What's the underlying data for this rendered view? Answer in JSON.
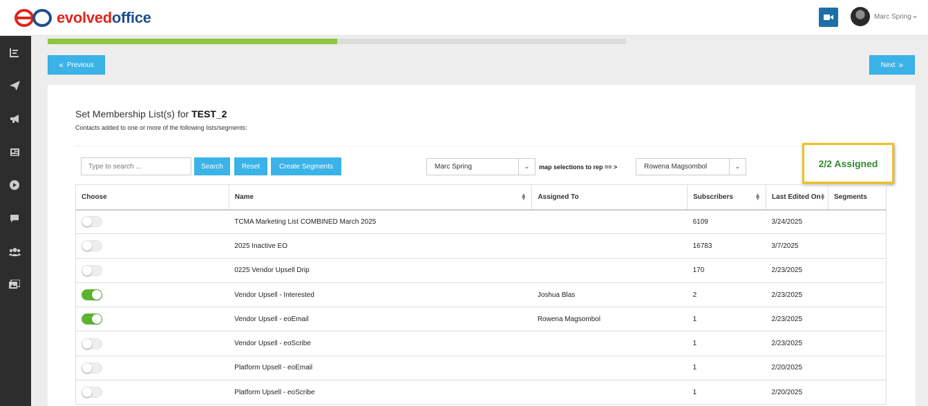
{
  "header": {
    "logo_part1": "evolved",
    "logo_part2": "office",
    "user_name": "Marc Spring"
  },
  "sidebar": {
    "items": [
      "chart-icon",
      "send-icon",
      "megaphone-icon",
      "newspaper-icon",
      "play-icon",
      "chat-icon",
      "users-icon",
      "gallery-icon"
    ]
  },
  "progress": {
    "fraction": 0.5
  },
  "nav": {
    "previous_label": "Previous",
    "next_label": "Next"
  },
  "main": {
    "title_prefix": "Set Membership List(s) for",
    "title_name": "TEST_2",
    "subtitle": "Contacts added to one or more of the following lists/segments:",
    "search_placeholder": "Type to search ...",
    "search_label": "Search",
    "reset_label": "Reset",
    "create_segments_label": "Create Segments",
    "rep_select_value": "Marc Spring",
    "map_label": "map selections to rep == >",
    "target_select_value": "Rowena Magsombol",
    "assigned_text": "2/2 Assigned"
  },
  "table": {
    "columns": [
      "Choose",
      "Name",
      "Assigned To",
      "Subscribers",
      "Last Edited On",
      "Segments"
    ],
    "rows": [
      {
        "on": false,
        "name": "TCMA Marketing List COMBINED March 2025",
        "assigned": "",
        "subscribers": "6109",
        "edited": "3/24/2025",
        "segments": ""
      },
      {
        "on": false,
        "name": "2025 Inactive EO",
        "assigned": "",
        "subscribers": "16783",
        "edited": "3/7/2025",
        "segments": ""
      },
      {
        "on": false,
        "name": "0225 Vendor Upsell Drip",
        "assigned": "",
        "subscribers": "170",
        "edited": "2/23/2025",
        "segments": ""
      },
      {
        "on": true,
        "name": "Vendor Upsell - Interested",
        "assigned": "Joshua Blas",
        "subscribers": "2",
        "edited": "2/23/2025",
        "segments": ""
      },
      {
        "on": true,
        "name": "Vendor Upsell - eoEmail",
        "assigned": "Rowena Magsombol",
        "subscribers": "1",
        "edited": "2/23/2025",
        "segments": ""
      },
      {
        "on": false,
        "name": "Vendor Upsell - eoScribe",
        "assigned": "",
        "subscribers": "1",
        "edited": "2/23/2025",
        "segments": ""
      },
      {
        "on": false,
        "name": "Platform Upsell - eoEmail",
        "assigned": "",
        "subscribers": "1",
        "edited": "2/20/2025",
        "segments": ""
      },
      {
        "on": false,
        "name": "Platform Upsell - eoScribe",
        "assigned": "",
        "subscribers": "1",
        "edited": "2/20/2025",
        "segments": ""
      }
    ]
  },
  "colors": {
    "accent_blue": "#3bb3e8",
    "progress_green": "#8dc63f",
    "toggle_on": "#5cb531",
    "assigned_text": "#2e8b2e",
    "highlight_border": "#f0c020"
  }
}
